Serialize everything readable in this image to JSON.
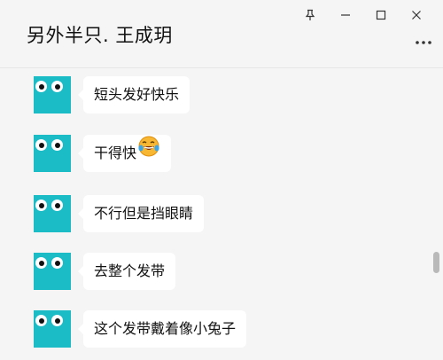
{
  "window": {
    "title": "另外半只. 王成玥",
    "controls": {
      "pin_icon": "pin-icon",
      "minimize_icon": "minimize-icon",
      "maximize_icon": "maximize-icon",
      "close_icon": "close-icon",
      "more_icon": "more-icon"
    }
  },
  "messages": [
    {
      "text": "短头发好快乐",
      "has_emoji": false
    },
    {
      "text": "干得快",
      "has_emoji": true,
      "emoji_name": "laughing-tears-emoji"
    },
    {
      "text": "不行但是挡眼睛",
      "has_emoji": false
    },
    {
      "text": "去整个发带",
      "has_emoji": false
    },
    {
      "text": "这个发带戴着像小兔子",
      "has_emoji": false
    }
  ],
  "colors": {
    "avatar": "#1bbcc6",
    "background": "#f5f5f5",
    "bubble": "#ffffff"
  }
}
